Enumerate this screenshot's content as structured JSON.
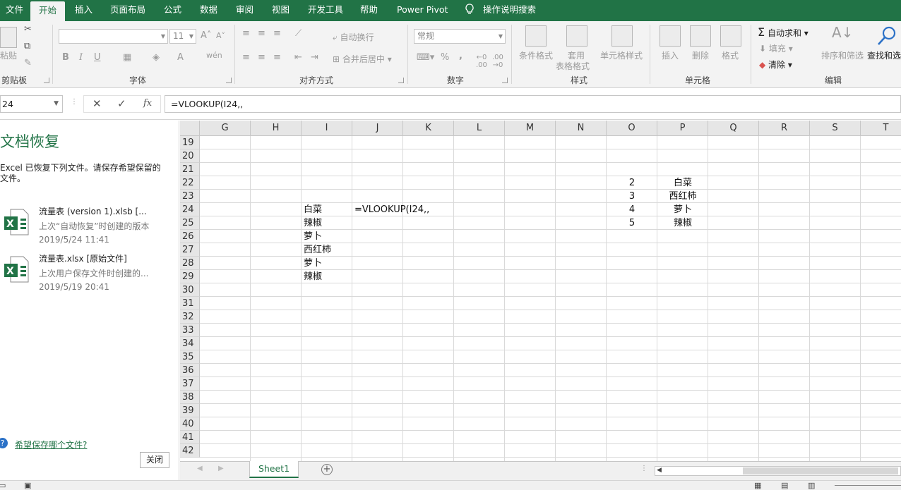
{
  "tabs": [
    "文件",
    "开始",
    "插入",
    "页面布局",
    "公式",
    "数据",
    "审阅",
    "视图",
    "开发工具",
    "帮助",
    "Power Pivot",
    "操作说明搜索"
  ],
  "ribbon": {
    "clipboard": {
      "paste": "粘贴",
      "label": "剪贴板"
    },
    "font": {
      "font_name": "",
      "font_size": "11",
      "bold": "B",
      "italic": "I",
      "underline": "U",
      "label": "字体"
    },
    "alignment": {
      "wrap": "自动换行",
      "merge": "合并后居中",
      "label": "对齐方式"
    },
    "number": {
      "format": "常规",
      "percent": "%",
      "comma": ",",
      "label": "数字"
    },
    "styles": {
      "conditional": "条件格式",
      "table1": "套用",
      "table2": "表格格式",
      "cell_styles": "单元格样式",
      "label": "样式"
    },
    "cells": {
      "insert": "插入",
      "delete": "删除",
      "format": "格式",
      "label": "单元格"
    },
    "editing": {
      "autosum": "自动求和",
      "fill": "填充",
      "clear": "清除",
      "sort": "排序和筛选",
      "find": "查找和选",
      "label": "编辑"
    }
  },
  "formula_bar": {
    "name_box": "24",
    "formula": "=VLOOKUP(I24,,"
  },
  "recovery": {
    "title": "文档恢复",
    "description": "Excel 已恢复下列文件。请保存希望保留的文件。",
    "files": [
      {
        "name": "流量表 (version 1).xlsb   [...",
        "sub": "上次“自动恢复”时创建的版本",
        "date": "2019/5/24 11:41"
      },
      {
        "name": "流量表.xlsx  [原始文件]",
        "sub": "上次用户保存文件时创建的...",
        "date": "2019/5/19 20:41"
      }
    ],
    "help": "希望保存哪个文件?",
    "close": "关闭"
  },
  "grid": {
    "columns": [
      "G",
      "H",
      "I",
      "J",
      "K",
      "L",
      "M",
      "N",
      "O",
      "P",
      "Q",
      "R",
      "S",
      "T"
    ],
    "rows": [
      "19",
      "20",
      "21",
      "22",
      "23",
      "24",
      "25",
      "26",
      "27",
      "28",
      "29",
      "30",
      "31",
      "32",
      "33",
      "34",
      "35",
      "36",
      "37",
      "38",
      "39",
      "40",
      "41",
      "42"
    ],
    "cells": {
      "I24": "白菜",
      "I25": "辣椒",
      "I26": "萝卜",
      "I27": "西红柿",
      "I28": "萝卜",
      "I29": "辣椒",
      "J24": "=VLOOKUP(I24,,",
      "O22": "2",
      "O23": "3",
      "O24": "4",
      "O25": "5",
      "P22": "白菜",
      "P23": "西红柿",
      "P24": "萝卜",
      "P25": "辣椒"
    }
  },
  "sheet_tab": "Sheet1"
}
